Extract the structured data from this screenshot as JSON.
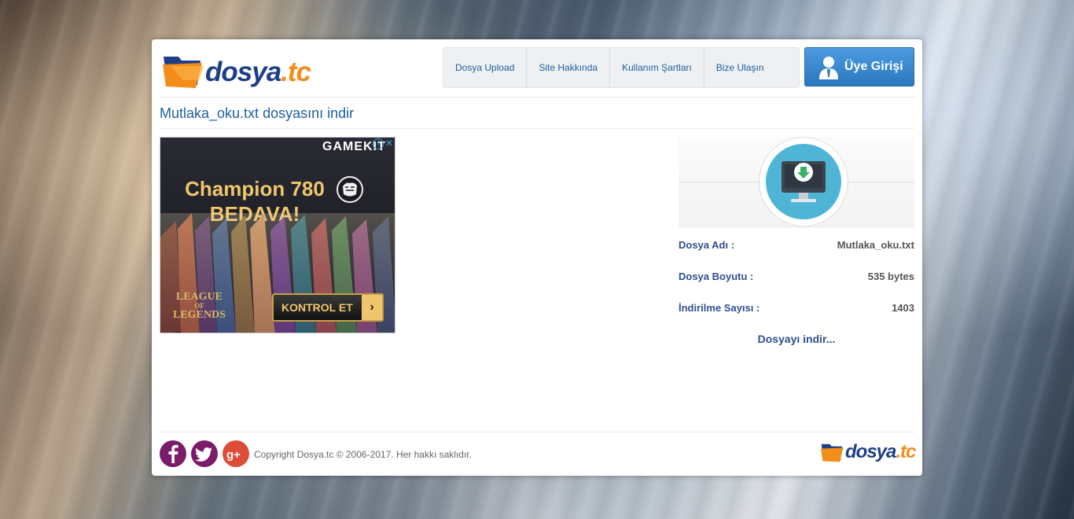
{
  "brand": {
    "name": "dosya",
    "tld": ".tc"
  },
  "nav": {
    "items": [
      {
        "label": "Dosya Upload"
      },
      {
        "label": "Site Hakkında"
      },
      {
        "label": "Kullanım Şartları"
      },
      {
        "label": "Bize Ulaşın"
      }
    ],
    "login_label": "Üye Girişi"
  },
  "page": {
    "title": "Mutlaka_oku.txt dosyasını indir"
  },
  "ad": {
    "brand": "GAMEKIT",
    "line1": "Champion 780",
    "line2": "BEDAVA!",
    "game_top": "LEAGUE",
    "game_of": "OF",
    "game_bottom": "LEGENDS",
    "cta": "KONTROL ET",
    "cta_arrow": "›",
    "info_glyph": "i",
    "close_glyph": "✕"
  },
  "file": {
    "name_label": "Dosya Adı :",
    "name_value": "Mutlaka_oku.txt",
    "size_label": "Dosya Boyutu :",
    "size_value": "535 bytes",
    "downloads_label": "İndirilme Sayısı :",
    "downloads_value": "1403",
    "download_link": "Dosyayı indir..."
  },
  "footer": {
    "copyright": "Copyright Dosya.tc © 2006-2017. Her hakkı saklıdır.",
    "social": [
      {
        "icon": "facebook-icon",
        "color": "#7b1c6a"
      },
      {
        "icon": "twitter-icon",
        "color": "#7b1c6a"
      },
      {
        "icon": "google-plus-icon",
        "color": "#dd4b39"
      }
    ]
  },
  "colors": {
    "brand_blue": "#1d3f87",
    "brand_orange": "#f28c1a",
    "link_blue": "#1f5fa0",
    "login_button": "#3a8ad0",
    "download_circle": "#4fb5d6"
  }
}
